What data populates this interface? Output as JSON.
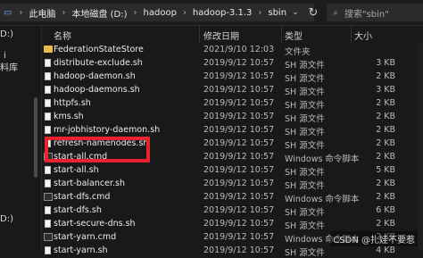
{
  "address": {
    "crumbs": [
      "此电脑",
      "本地磁盘 (D:)",
      "hadoop",
      "hadoop-3.1.3",
      "sbin"
    ],
    "search_placeholder": "搜索\"sbin\""
  },
  "sidebar": {
    "items": [
      "D:)",
      "i",
      "料库",
      "D:)"
    ]
  },
  "columns": {
    "name": "名称",
    "date": "修改日期",
    "type": "类型",
    "size": "大小"
  },
  "files": [
    {
      "name": "FederationStateStore",
      "date": "2021/9/10 12:03",
      "type": "文件夹",
      "size": "",
      "icon": "folder-icon"
    },
    {
      "name": "distribute-exclude.sh",
      "date": "2019/9/12 10:57",
      "type": "SH 源文件",
      "size": "3 KB",
      "icon": "file-icon"
    },
    {
      "name": "hadoop-daemon.sh",
      "date": "2019/9/12 10:57",
      "type": "SH 源文件",
      "size": "2 KB",
      "icon": "file-icon"
    },
    {
      "name": "hadoop-daemons.sh",
      "date": "2019/9/12 10:57",
      "type": "SH 源文件",
      "size": "3 KB",
      "icon": "file-icon"
    },
    {
      "name": "httpfs.sh",
      "date": "2019/9/12 10:57",
      "type": "SH 源文件",
      "size": "2 KB",
      "icon": "file-icon"
    },
    {
      "name": "kms.sh",
      "date": "2019/9/12 10:57",
      "type": "SH 源文件",
      "size": "2 KB",
      "icon": "file-icon"
    },
    {
      "name": "mr-jobhistory-daemon.sh",
      "date": "2019/9/12 10:57",
      "type": "SH 源文件",
      "size": "2 KB",
      "icon": "file-icon"
    },
    {
      "name": "refresh-namenodes.sh",
      "date": "2019/9/12 10:57",
      "type": "SH 源文件",
      "size": "2 KB",
      "icon": "file-icon"
    },
    {
      "name": "start-all.cmd",
      "date": "2019/9/12 10:57",
      "type": "Windows 命令脚本",
      "size": "2 KB",
      "icon": "cmd-icon"
    },
    {
      "name": "start-all.sh",
      "date": "2019/9/12 10:57",
      "type": "SH 源文件",
      "size": "5 KB",
      "icon": "file-icon"
    },
    {
      "name": "start-balancer.sh",
      "date": "2019/9/12 10:57",
      "type": "SH 源文件",
      "size": "2 KB",
      "icon": "file-icon"
    },
    {
      "name": "start-dfs.cmd",
      "date": "2019/9/12 10:57",
      "type": "Windows 命令脚本",
      "size": "2 KB",
      "icon": "cmd-icon"
    },
    {
      "name": "start-dfs.sh",
      "date": "2019/9/12 10:57",
      "type": "SH 源文件",
      "size": "6 KB",
      "icon": "file-icon"
    },
    {
      "name": "start-secure-dns.sh",
      "date": "2019/9/12 10:57",
      "type": "SH 源文件",
      "size": "2 KB",
      "icon": "file-icon"
    },
    {
      "name": "start-yarn.cmd",
      "date": "2019/9/12 10:57",
      "type": "Windows 命令脚本",
      "size": "2 KB",
      "icon": "cmd-icon"
    },
    {
      "name": "start-yarn.sh",
      "date": "2019/9/12 10:57",
      "type": "SH 源文件",
      "size": "4 KB",
      "icon": "file-icon"
    }
  ],
  "watermark": "CSDN @扎娃不要惹",
  "colors": {
    "highlight": "#e8232f",
    "background": "#191919"
  }
}
